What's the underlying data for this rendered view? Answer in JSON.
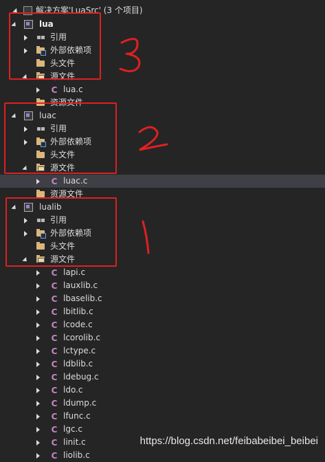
{
  "solution": {
    "label": "解决方案'LuaSrc' (3 个项目)"
  },
  "common": {
    "ref": "引用",
    "ext": "外部依赖项",
    "hdr": "头文件",
    "src": "源文件",
    "res": "资源文件"
  },
  "projects": {
    "lua": {
      "name": "lua",
      "files": [
        "lua.c"
      ]
    },
    "luac": {
      "name": "luac",
      "files": [
        "luac.c"
      ]
    },
    "lualib": {
      "name": "lualib",
      "files": [
        "lapi.c",
        "lauxlib.c",
        "lbaselib.c",
        "lbitlib.c",
        "lcode.c",
        "lcorolib.c",
        "lctype.c",
        "ldblib.c",
        "ldebug.c",
        "ldo.c",
        "ldump.c",
        "lfunc.c",
        "lgc.c",
        "linit.c",
        "liolib.c"
      ]
    }
  },
  "annotations": {
    "box1": "3",
    "box2": "2",
    "box3": "1"
  },
  "watermark": "https://blog.csdn.net/feibabeibei_beibei",
  "colors": {
    "background": "#252526",
    "selection": "#3f3f46",
    "c_icon": "#c586c0",
    "folder": "#dcb67a",
    "annotation_red": "#e02020"
  }
}
